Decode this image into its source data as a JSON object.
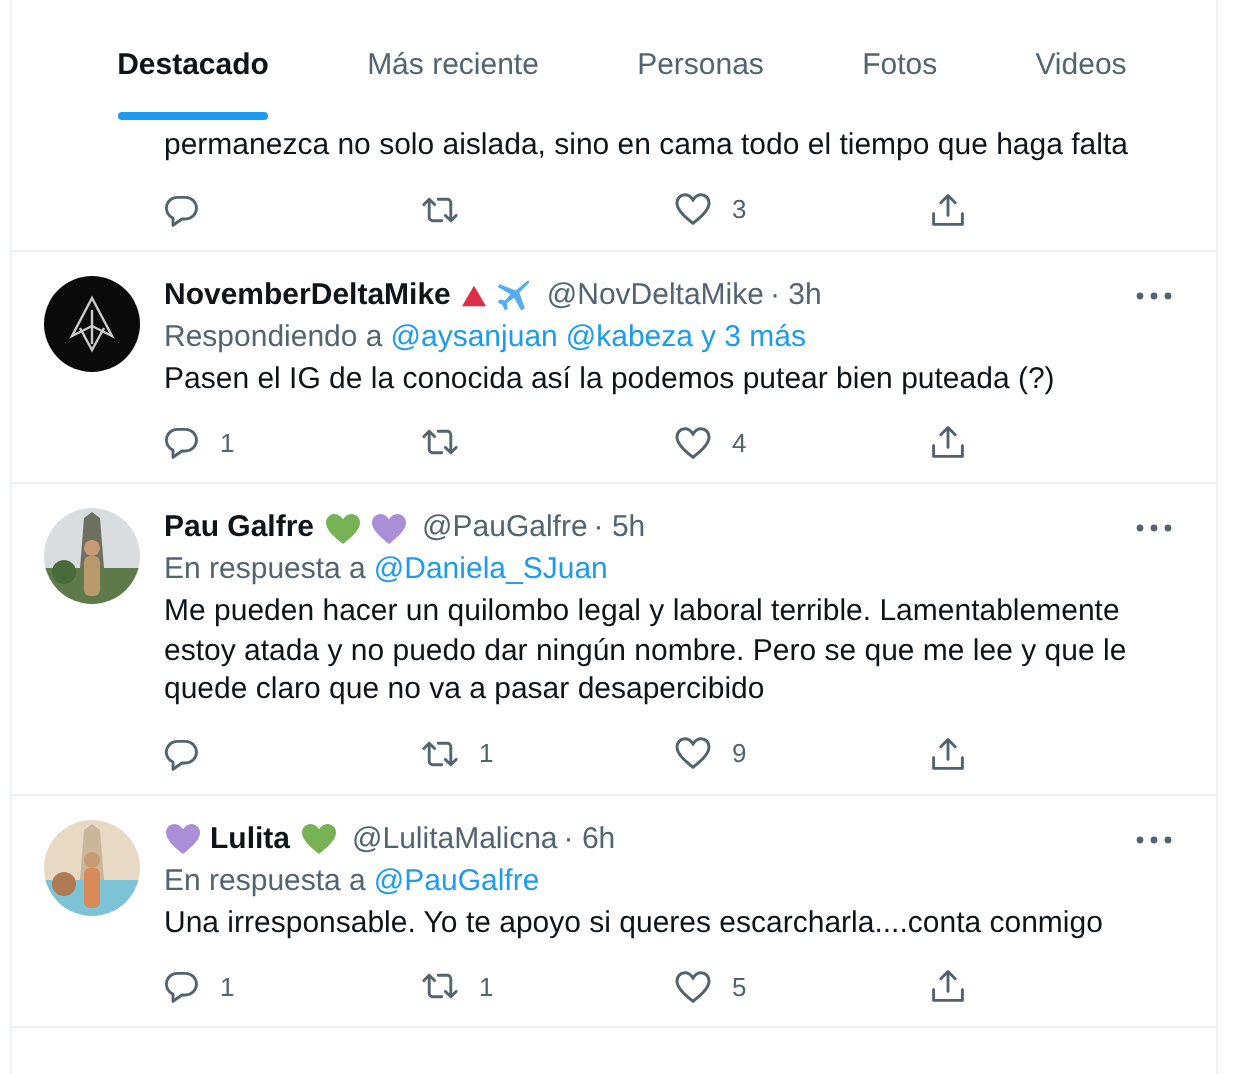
{
  "tabs": [
    {
      "label": "Destacado",
      "selected": true
    },
    {
      "label": "Más reciente",
      "selected": false
    },
    {
      "label": "Personas",
      "selected": false
    },
    {
      "label": "Fotos",
      "selected": false
    },
    {
      "label": "Videos",
      "selected": false
    }
  ],
  "tweets": [
    {
      "text_lines": [
        "permanezca no solo aislada, sino en cama todo el tiempo que haga falta"
      ],
      "actions": {
        "likes": "3"
      }
    },
    {
      "avatar": {
        "kind": "logo"
      },
      "name": "NovemberDeltaMike",
      "badges_after": [
        {
          "kind": "triangle",
          "color": "#dd2e44"
        },
        {
          "kind": "plane",
          "color": "#55acee"
        }
      ],
      "handle": "@NovDeltaMike",
      "time": "· 3h",
      "reply": {
        "prefix": "Respondiendo a",
        "mentions": [
          "@aysanjuan",
          "@kabeza",
          "y 3 más"
        ]
      },
      "text_lines": [
        "Pasen el IG de la conocida así la podemos putear bien puteada (?)"
      ],
      "actions": {
        "replies": "1",
        "likes": "4"
      }
    },
    {
      "avatar": {
        "kind": "picture"
      },
      "name": "Pau Galfre",
      "badges_after": [
        {
          "kind": "heart",
          "color": "#77b255"
        },
        {
          "kind": "heart",
          "color": "#aa8ed6"
        }
      ],
      "handle": "@PauGalfre",
      "time": "· 5h",
      "reply": {
        "prefix": "En respuesta a",
        "mentions": [
          "@Daniela_SJuan"
        ]
      },
      "text_lines": [
        "Me pueden hacer un quilombo legal y laboral terrible. Lamentablemente",
        "estoy atada y no puedo dar ningún nombre. Pero se que me lee y que le",
        "quede claro que no va a pasar desapercibido"
      ],
      "actions": {
        "retweets": "1",
        "likes": "9"
      }
    },
    {
      "avatar": {
        "kind": "picture"
      },
      "name": "Lulita",
      "badges_before": [
        {
          "kind": "heart",
          "color": "#aa8ed6"
        }
      ],
      "badges_after": [
        {
          "kind": "heart",
          "color": "#77b255"
        }
      ],
      "handle": "@LulitaMalicna",
      "time": "· 6h",
      "reply": {
        "prefix": "En respuesta a",
        "mentions": [
          "@PauGalfre"
        ]
      },
      "text_lines": [
        "Una irresponsable. Yo te apoyo si queres escarcharla....conta conmigo"
      ],
      "actions": {
        "replies": "1",
        "retweets": "1",
        "likes": "5"
      }
    }
  ]
}
